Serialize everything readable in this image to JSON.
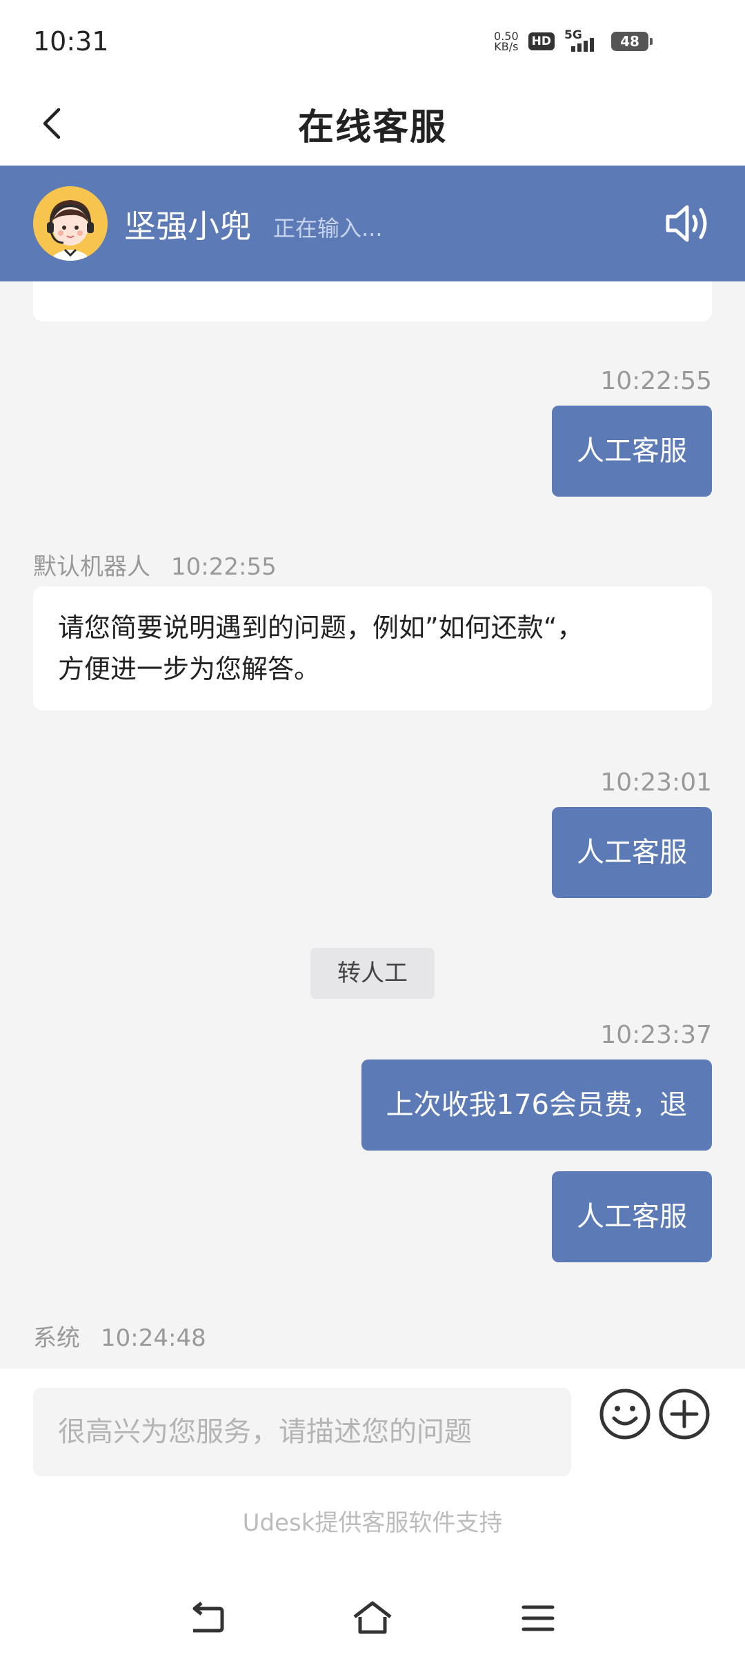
{
  "status_bar": {
    "time": "10:31",
    "net_speed_value": "0.50",
    "net_speed_unit": "KB/s",
    "hd": "HD",
    "network": "5G",
    "battery": "48"
  },
  "nav": {
    "title": "在线客服",
    "back_icon": "chevron-left-icon"
  },
  "agent": {
    "name": "坚强小兜",
    "status": "正在输入...",
    "speaker_icon": "speaker-icon"
  },
  "chat": {
    "messages": [
      {
        "type": "sent",
        "time": "10:22:55",
        "text": "人工客服"
      },
      {
        "type": "received",
        "sender": "默认机器人",
        "time": "10:22:55",
        "text_line1": "请您简要说明遇到的问题，例如”如何还款“，",
        "text_line2": "方便进一步为您解答。"
      },
      {
        "type": "sent",
        "time": "10:23:01",
        "text": "人工客服"
      },
      {
        "type": "system",
        "text": "转人工"
      },
      {
        "type": "sent",
        "time": "10:23:37",
        "text": "上次收我176会员费，退"
      },
      {
        "type": "sent",
        "text": "人工客服"
      },
      {
        "type": "received_meta",
        "sender": "系统",
        "time": "10:24:48"
      }
    ]
  },
  "composer": {
    "placeholder": "很高兴为您服务，请描述您的问题",
    "emoji_icon": "smiley-icon",
    "add_icon": "plus-circle-icon",
    "powered_by": "Udesk提供客服软件支持"
  },
  "colors": {
    "brand": "#5b7ab6",
    "background": "#f4f4f4"
  }
}
